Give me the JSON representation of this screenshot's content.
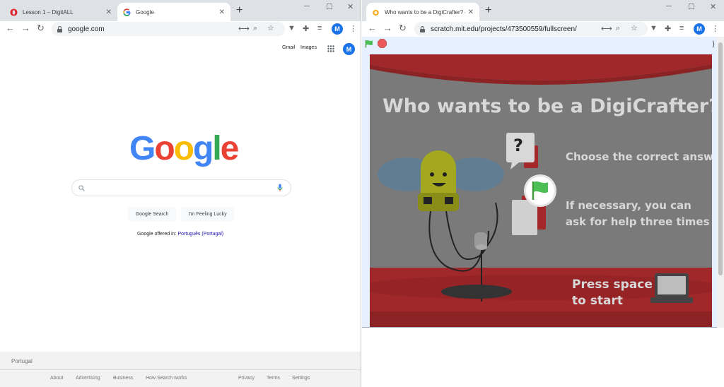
{
  "left_window": {
    "tabs": [
      {
        "title": "Lesson 1 – DigitALL",
        "active": false
      },
      {
        "title": "Google",
        "active": true
      }
    ],
    "address": "google.com",
    "profile_initial": "M",
    "google": {
      "header_links": [
        "Gmail",
        "Images"
      ],
      "logo": [
        "G",
        "o",
        "o",
        "g",
        "l",
        "e"
      ],
      "logo_colors": [
        "#4285f4",
        "#ea4335",
        "#fbbc05",
        "#4285f4",
        "#34a853",
        "#ea4335"
      ],
      "search_placeholder": "",
      "buttons": [
        "Google Search",
        "I'm Feeling Lucky"
      ],
      "offered_prefix": "Google offered in:",
      "offered_language": "Português (Portugal)",
      "country": "Portugal",
      "footer_left": [
        "About",
        "Advertising",
        "Business",
        "How Search works"
      ],
      "footer_right": [
        "Privacy",
        "Terms",
        "Settings"
      ]
    }
  },
  "right_window": {
    "tabs": [
      {
        "title": "Who wants to be a DigiCrafter? o",
        "active": true
      }
    ],
    "address": "scratch.mit.edu/projects/473500559/fullscreen/",
    "profile_initial": "M",
    "project": {
      "title": "Who wants to be a DigiCrafter?",
      "line1": "Choose the correct answer",
      "line2a": "If necessary, you can",
      "line2b": "ask for help three times",
      "press1": "Press space",
      "press2": "to start",
      "question_mark": "?"
    }
  },
  "colors": {
    "accent_blue": "#1a73e8",
    "stage_red": "#a0282a",
    "stage_gray": "#7a7a7a",
    "flag_green": "#4cbf56",
    "stop_red": "#ec5959"
  }
}
